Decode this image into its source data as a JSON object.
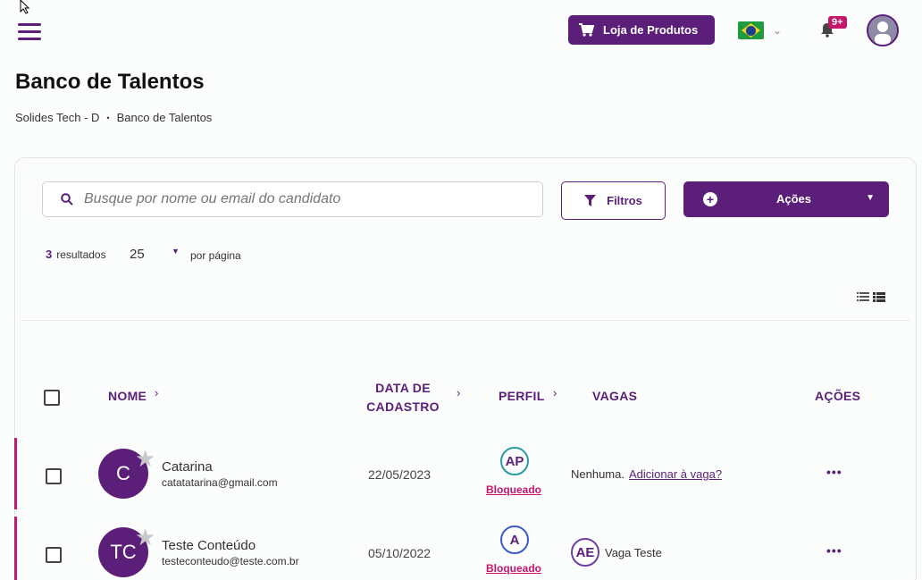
{
  "header": {
    "shop_label": "Loja de Produtos",
    "notification_count": "9+",
    "language": "pt-BR"
  },
  "page": {
    "title": "Banco de Talentos",
    "breadcrumb": [
      "Solides Tech - D",
      "•",
      "Banco de Talentos"
    ]
  },
  "toolbar": {
    "search_placeholder": "Busque por nome ou email do candidato",
    "filter_label": "Filtros",
    "actions_label": "Ações"
  },
  "pagination": {
    "results_count": "3",
    "results_label": "resultados",
    "per_page": "25",
    "per_page_label": "por página"
  },
  "table": {
    "columns": {
      "name": "NOME",
      "date_line1": "DATA DE",
      "date_line2": "CADASTRO",
      "profile": "PERFIL",
      "vagas": "VAGAS",
      "actions": "AÇÕES"
    },
    "rows": [
      {
        "initials": "C",
        "name": "Catarina",
        "email": "catatatarina@gmail.com",
        "date": "22/05/2023",
        "profile_initials": "AP",
        "profile_status": "Bloqueado",
        "vagas_text": "Nenhuma.",
        "vagas_link": "Adicionar à vaga?",
        "actions": "•••"
      },
      {
        "initials": "TC",
        "name": "Teste Conteúdo",
        "email": "testeconteudo@teste.com.br",
        "date": "05/10/2022",
        "profile_initials": "A",
        "profile_status": "Bloqueado",
        "vaga_initials": "AE",
        "vaga_name": "Vaga Teste",
        "actions": "•••"
      }
    ]
  },
  "colors": {
    "brand": "#5b1f7a",
    "accent": "#c4166b"
  }
}
